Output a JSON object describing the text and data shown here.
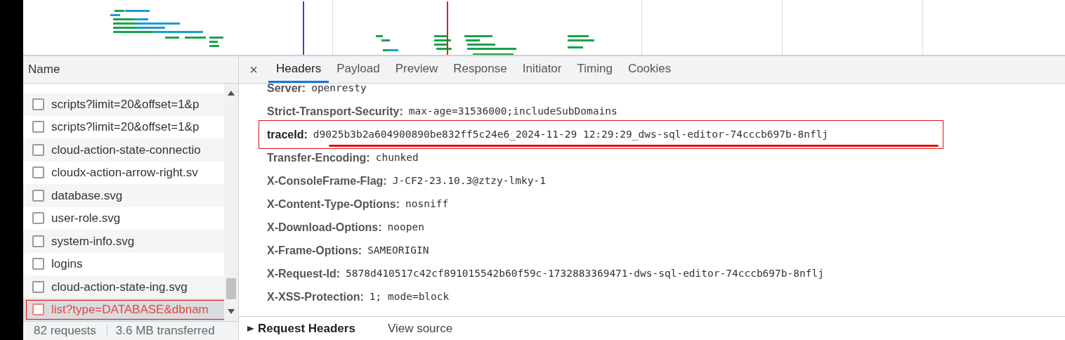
{
  "name_column": {
    "title": "Name"
  },
  "requests": [
    {
      "name": "scripts?limit=20&offset=1&p",
      "selected": false,
      "failed": false
    },
    {
      "name": "scripts?limit=20&offset=1&p",
      "selected": false,
      "failed": false
    },
    {
      "name": "cloud-action-state-connectio",
      "selected": false,
      "failed": false
    },
    {
      "name": "cloudx-action-arrow-right.sv",
      "selected": false,
      "failed": false
    },
    {
      "name": "database.svg",
      "selected": false,
      "failed": false
    },
    {
      "name": "user-role.svg",
      "selected": false,
      "failed": false
    },
    {
      "name": "system-info.svg",
      "selected": false,
      "failed": false
    },
    {
      "name": "logins",
      "selected": false,
      "failed": false
    },
    {
      "name": "cloud-action-state-ing.svg",
      "selected": false,
      "failed": false
    },
    {
      "name": "list?type=DATABASE&dbnam",
      "selected": true,
      "failed": true
    }
  ],
  "status_bar": {
    "requests": "82 requests",
    "transferred": "3.6 MB transferred"
  },
  "close": "×",
  "tabs": [
    {
      "label": "Headers",
      "selected": true
    },
    {
      "label": "Payload",
      "selected": false
    },
    {
      "label": "Preview",
      "selected": false
    },
    {
      "label": "Response",
      "selected": false
    },
    {
      "label": "Initiator",
      "selected": false
    },
    {
      "label": "Timing",
      "selected": false
    },
    {
      "label": "Cookies",
      "selected": false
    }
  ],
  "response_headers": [
    {
      "name": "Server:",
      "value": "openresty",
      "highlighted": false
    },
    {
      "name": "Strict-Transport-Security:",
      "value": "max-age=31536000;includeSubDomains",
      "highlighted": false
    },
    {
      "name": "traceId:",
      "value": "d9025b3b2a604900890be832ff5c24e6_2024-11-29 12:29:29_dws-sql-editor-74cccb697b-8nflj",
      "highlighted": true
    },
    {
      "name": "Transfer-Encoding:",
      "value": "chunked",
      "highlighted": false
    },
    {
      "name": "X-ConsoleFrame-Flag:",
      "value": "J-CF2-23.10.3@ztzy-lmky-1",
      "highlighted": false
    },
    {
      "name": "X-Content-Type-Options:",
      "value": "nosniff",
      "highlighted": false
    },
    {
      "name": "X-Download-Options:",
      "value": "noopen",
      "highlighted": false
    },
    {
      "name": "X-Frame-Options:",
      "value": "SAMEORIGIN",
      "highlighted": false
    },
    {
      "name": "X-Request-Id:",
      "value": "5878d410517c42cf891015542b60f59c-1732883369471-dws-sql-editor-74cccb697b-8nflj",
      "highlighted": false
    },
    {
      "name": "X-XSS-Protection:",
      "value": "1; mode=block",
      "highlighted": false
    }
  ],
  "request_headers": {
    "title": "Request Headers",
    "expanded": false,
    "link": "View source"
  }
}
